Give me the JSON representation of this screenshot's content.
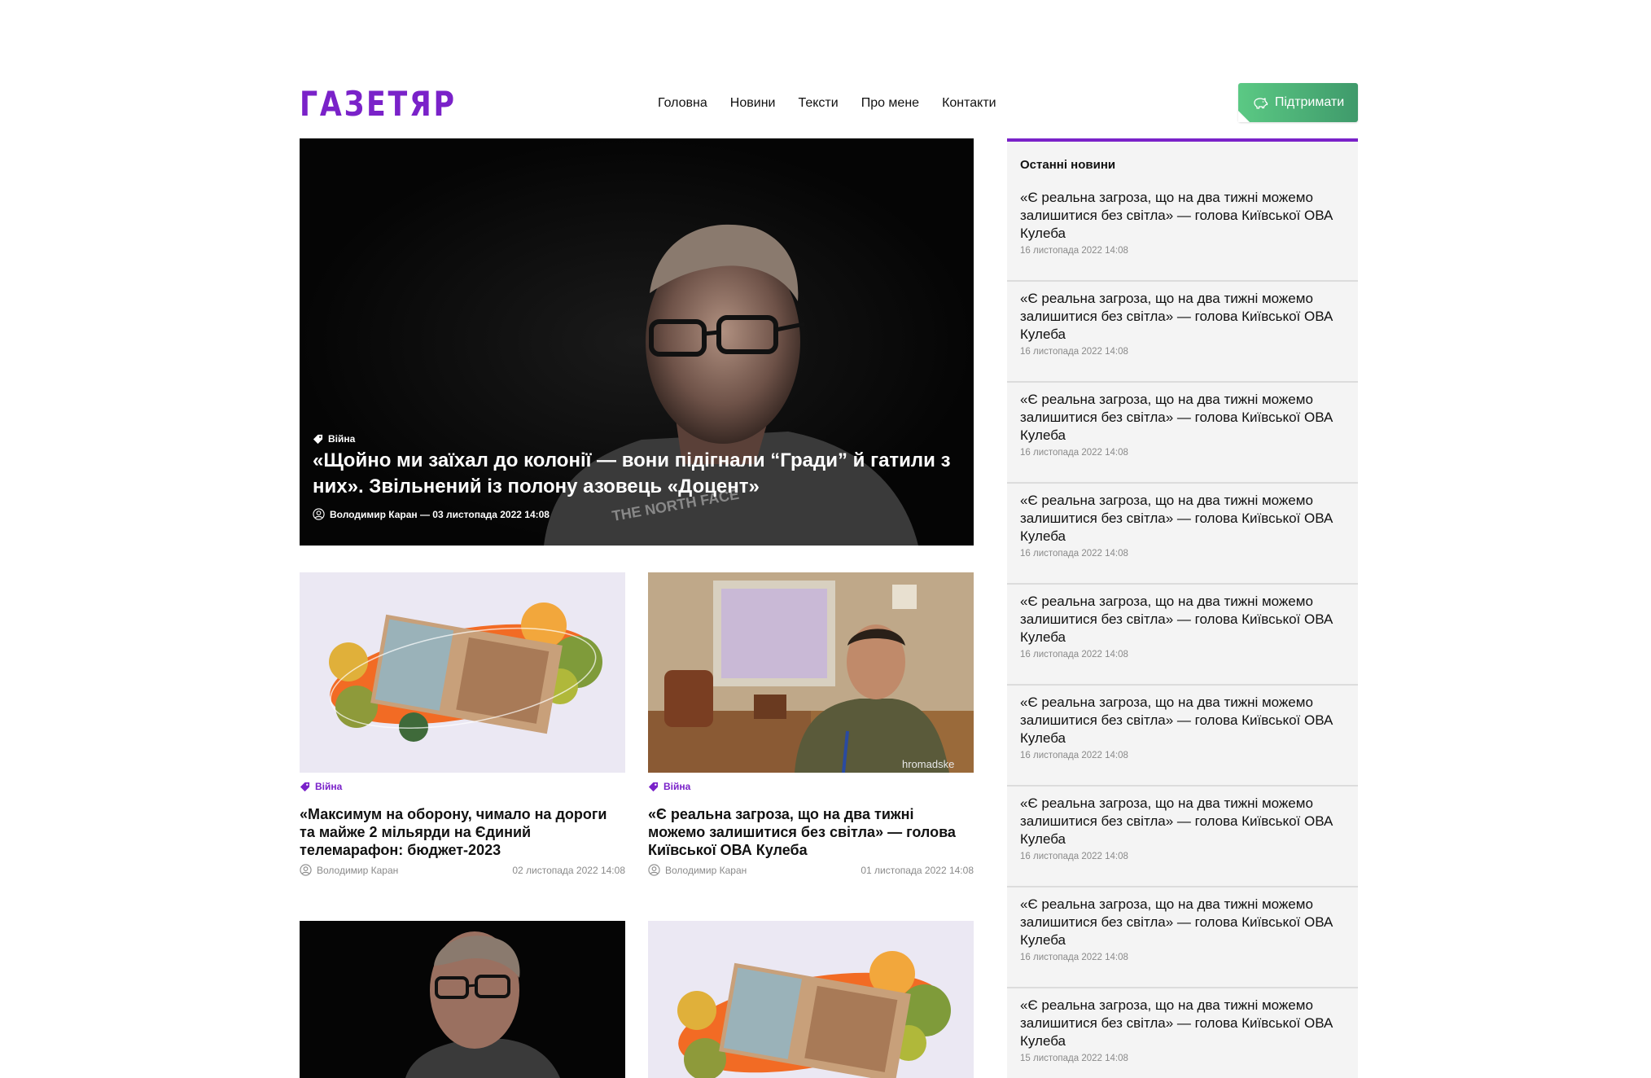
{
  "header": {
    "logo": "ГАЗЕТЯР",
    "nav": [
      "Головна",
      "Новини",
      "Тексти",
      "Про мене",
      "Контакти"
    ],
    "support_label": "Підтримати"
  },
  "hero": {
    "tag": "Війна",
    "title": "«Щойно ми заїхал до колонії — вони підігнали “Гради” й гатили з них». Звільнений із полону азовець «Доцент»",
    "meta": "Володимир Каран — 03 листопада 2022 14:08"
  },
  "cards": [
    {
      "tag": "Війна",
      "title": "«Максимум на оборону, чимало на дороги та майже 2 мільярди на Єдиний телемарафон: бюджет-2023",
      "author": "Володимир Каран",
      "date": "02 листопада 2022 14:08"
    },
    {
      "tag": "Війна",
      "title": "«Є реальна загроза, що на два тижні можемо залишитися без світла» — голова Київської ОВА Кулеба",
      "author": "Володимир Каран",
      "date": "01 листопада 2022 14:08",
      "watermark": "hromadske"
    }
  ],
  "sidebar": {
    "title": "Останні новини",
    "items": [
      {
        "title": "«Є реальна загроза, що на два тижні можемо залишитися без світла» — голова Київської ОВА Кулеба",
        "date": "16 листопада 2022 14:08"
      },
      {
        "title": "«Є реальна загроза, що на два тижні можемо залишитися без світла» — голова Київської ОВА Кулеба",
        "date": "16 листопада 2022 14:08"
      },
      {
        "title": "«Є реальна загроза, що на два тижні можемо залишитися без світла» — голова Київської ОВА Кулеба",
        "date": "16 листопада 2022 14:08"
      },
      {
        "title": "«Є реальна загроза, що на два тижні можемо залишитися без світла» — голова Київської ОВА Кулеба",
        "date": "16 листопада 2022 14:08"
      },
      {
        "title": "«Є реальна загроза, що на два тижні можемо залишитися без світла» — голова Київської ОВА Кулеба",
        "date": "16 листопада 2022 14:08"
      },
      {
        "title": "«Є реальна загроза, що на два тижні можемо залишитися без світла» — голова Київської ОВА Кулеба",
        "date": "16 листопада 2022 14:08"
      },
      {
        "title": "«Є реальна загроза, що на два тижні можемо залишитися без світла» — голова Київської ОВА Кулеба",
        "date": "16 листопада 2022 14:08"
      },
      {
        "title": "«Є реальна загроза, що на два тижні можемо залишитися без світла» — голова Київської ОВА Кулеба",
        "date": "16 листопада 2022 14:08"
      },
      {
        "title": "«Є реальна загроза, що на два тижні можемо залишитися без світла» — голова Київської ОВА Кулеба",
        "date": "15 листопада 2022 14:08"
      }
    ]
  },
  "colors": {
    "brand": "#7a22c9",
    "support_green": "#4fb57a"
  }
}
